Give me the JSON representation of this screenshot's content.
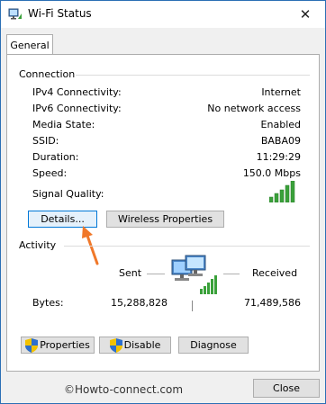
{
  "window": {
    "title": "Wi-Fi Status",
    "close_glyph": "✕"
  },
  "tabs": [
    {
      "label": "General"
    }
  ],
  "connection": {
    "heading": "Connection",
    "rows": [
      {
        "label": "IPv4 Connectivity:",
        "value": "Internet"
      },
      {
        "label": "IPv6 Connectivity:",
        "value": "No network access"
      },
      {
        "label": "Media State:",
        "value": "Enabled"
      },
      {
        "label": "SSID:",
        "value": "BABA09"
      },
      {
        "label": "Duration:",
        "value": "11:29:29"
      },
      {
        "label": "Speed:",
        "value": "150.0 Mbps"
      }
    ],
    "signal_label": "Signal Quality:",
    "signal_bars": 5,
    "details_button": "Details...",
    "wireless_button": "Wireless Properties"
  },
  "activity": {
    "heading": "Activity",
    "sent_label": "Sent",
    "received_label": "Received",
    "bytes_label": "Bytes:",
    "bytes_sent": "15,288,828",
    "bytes_received": "71,489,586"
  },
  "buttons": {
    "properties": "Properties",
    "disable": "Disable",
    "diagnose": "Diagnose",
    "close": "Close"
  },
  "watermark": "©Howto-connect.com",
  "colors": {
    "signal_green": "#3aa13a",
    "annotation_arrow": "#f0782a",
    "window_border": "#2b6fb5"
  },
  "icons": {
    "title": "network-icon",
    "signal": "signal-bars-icon",
    "computers": "network-computers-icon",
    "shield": "uac-shield-icon",
    "arrow": "orange-annotation-arrow"
  }
}
